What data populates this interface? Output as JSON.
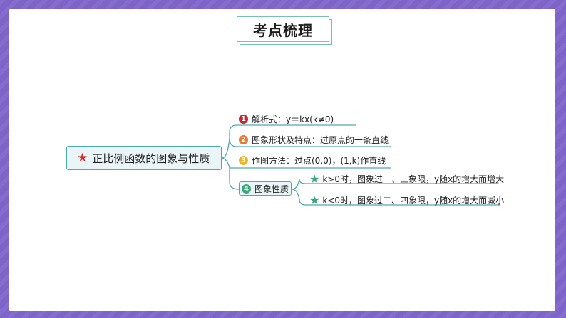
{
  "title": "考点梳理",
  "root": {
    "label": "正比例函数的图象与性质",
    "icon": "star-icon",
    "icon_color": "#d12a2a"
  },
  "branches": [
    {
      "num": "1",
      "color": "#c9252c",
      "text": "解析式：y＝kx(k≠0)"
    },
    {
      "num": "2",
      "color": "#e8792f",
      "text": "图象形状及特点：过原点的一条直线"
    },
    {
      "num": "3",
      "color": "#f0b323",
      "text": "作图方法：过点(0,0)，(1,k)作直线"
    },
    {
      "num": "4",
      "color": "#3aa87a",
      "text": "图象性质",
      "children": [
        {
          "icon": "green-star-icon",
          "text": "k>0时，图象过一、三象限，y随x的增大而增大"
        },
        {
          "icon": "green-star-icon",
          "text": "k<0时，图象过二、四象限，y随x的增大而减小"
        }
      ]
    }
  ]
}
